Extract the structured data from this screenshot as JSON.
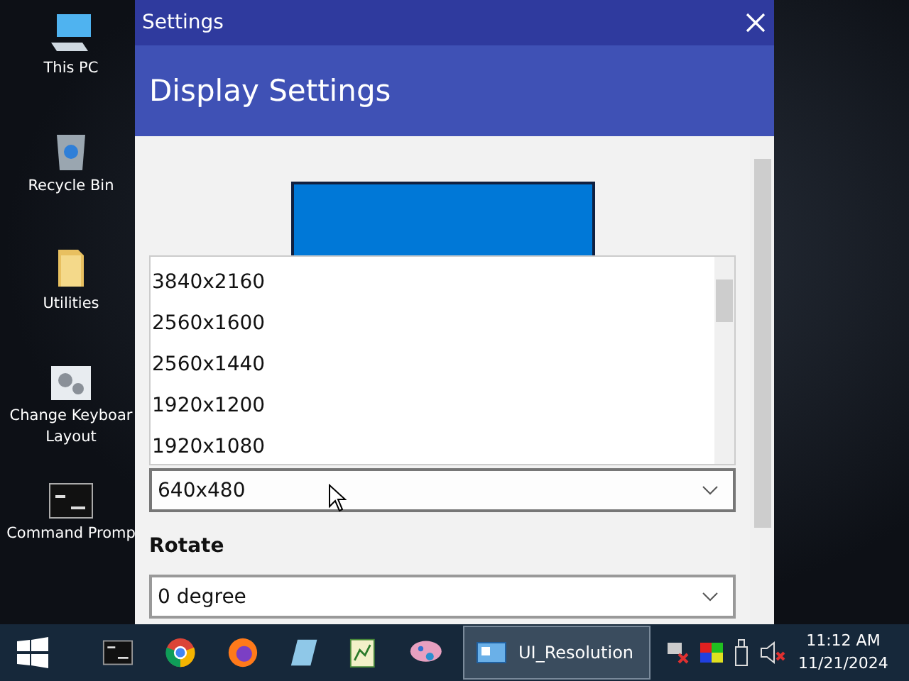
{
  "desktop_icons": [
    {
      "kind": "computer",
      "label": "This PC"
    },
    {
      "kind": "bin",
      "label": "Recycle Bin"
    },
    {
      "kind": "folder",
      "label": "Utilities"
    },
    {
      "kind": "gears",
      "label": "Change Keyboar Layout"
    },
    {
      "kind": "console",
      "label": "Command Promp"
    }
  ],
  "window": {
    "title": "Settings",
    "header": "Display Settings",
    "resolution": {
      "value": "640x480",
      "expanded": true,
      "options": [
        "3840x2160",
        "2560x1600",
        "2560x1440",
        "1920x1200",
        "1920x1080"
      ]
    },
    "rotate": {
      "label": "Rotate",
      "value": "0 degree"
    }
  },
  "taskbar": {
    "apps": [
      {
        "kind": "console"
      },
      {
        "kind": "chrome"
      },
      {
        "kind": "firefox"
      },
      {
        "kind": "notepad"
      },
      {
        "kind": "chart"
      },
      {
        "kind": "paint"
      }
    ],
    "active_app": {
      "label": "UI_Resolution",
      "selected": true
    },
    "clock": {
      "time": "11:12 AM",
      "date": "11/21/2024"
    }
  }
}
